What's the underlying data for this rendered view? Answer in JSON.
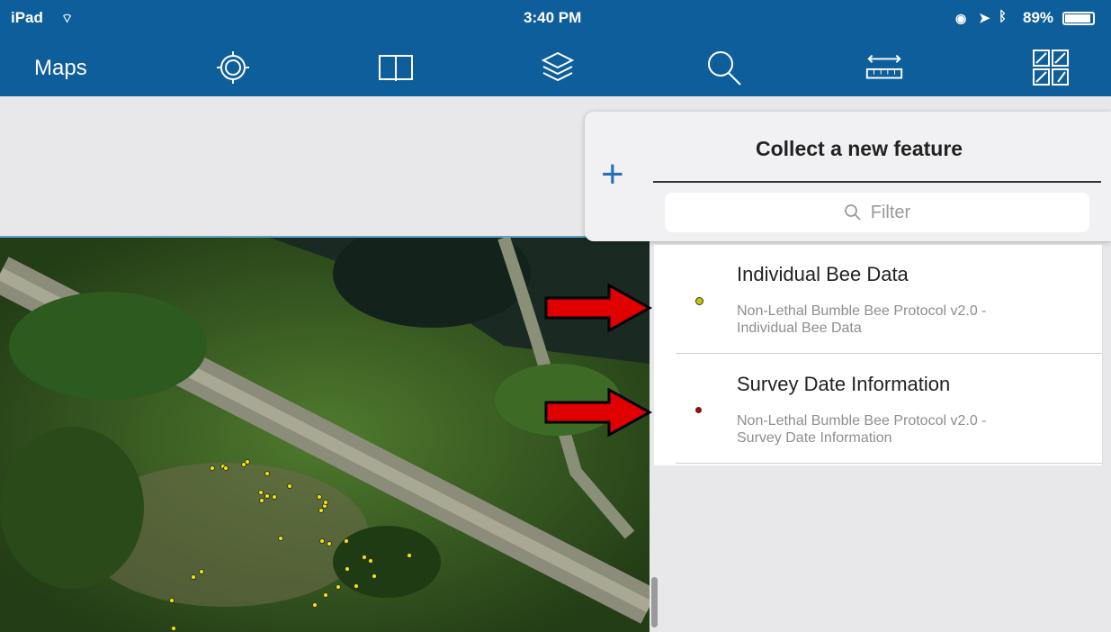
{
  "status": {
    "device": "iPad",
    "time": "3:40 PM",
    "battery": "89%"
  },
  "nav": {
    "title": "Maps",
    "icons": [
      "locate-icon",
      "bookmarks-icon",
      "layers-icon",
      "search-icon",
      "measure-icon",
      "sketch-icon"
    ]
  },
  "panel": {
    "title": "Collect a new feature",
    "filter_placeholder": "Filter",
    "items": [
      {
        "title": "Individual Bee Data",
        "subtitle_line1": "Non-Lethal Bumble Bee Protocol v2.0 -",
        "subtitle_line2": "Individual Bee Data",
        "dot_color": "#c8c800"
      },
      {
        "title": "Survey Date Information",
        "subtitle_line1": "Non-Lethal Bumble Bee Protocol v2.0 -",
        "subtitle_line2": "Survey Date Information",
        "dot_color": "#8b1010"
      }
    ]
  },
  "colors": {
    "nav_bg": "#0f5e9c",
    "accent": "#2b6fb8",
    "annotation_arrow": "#e00000"
  }
}
